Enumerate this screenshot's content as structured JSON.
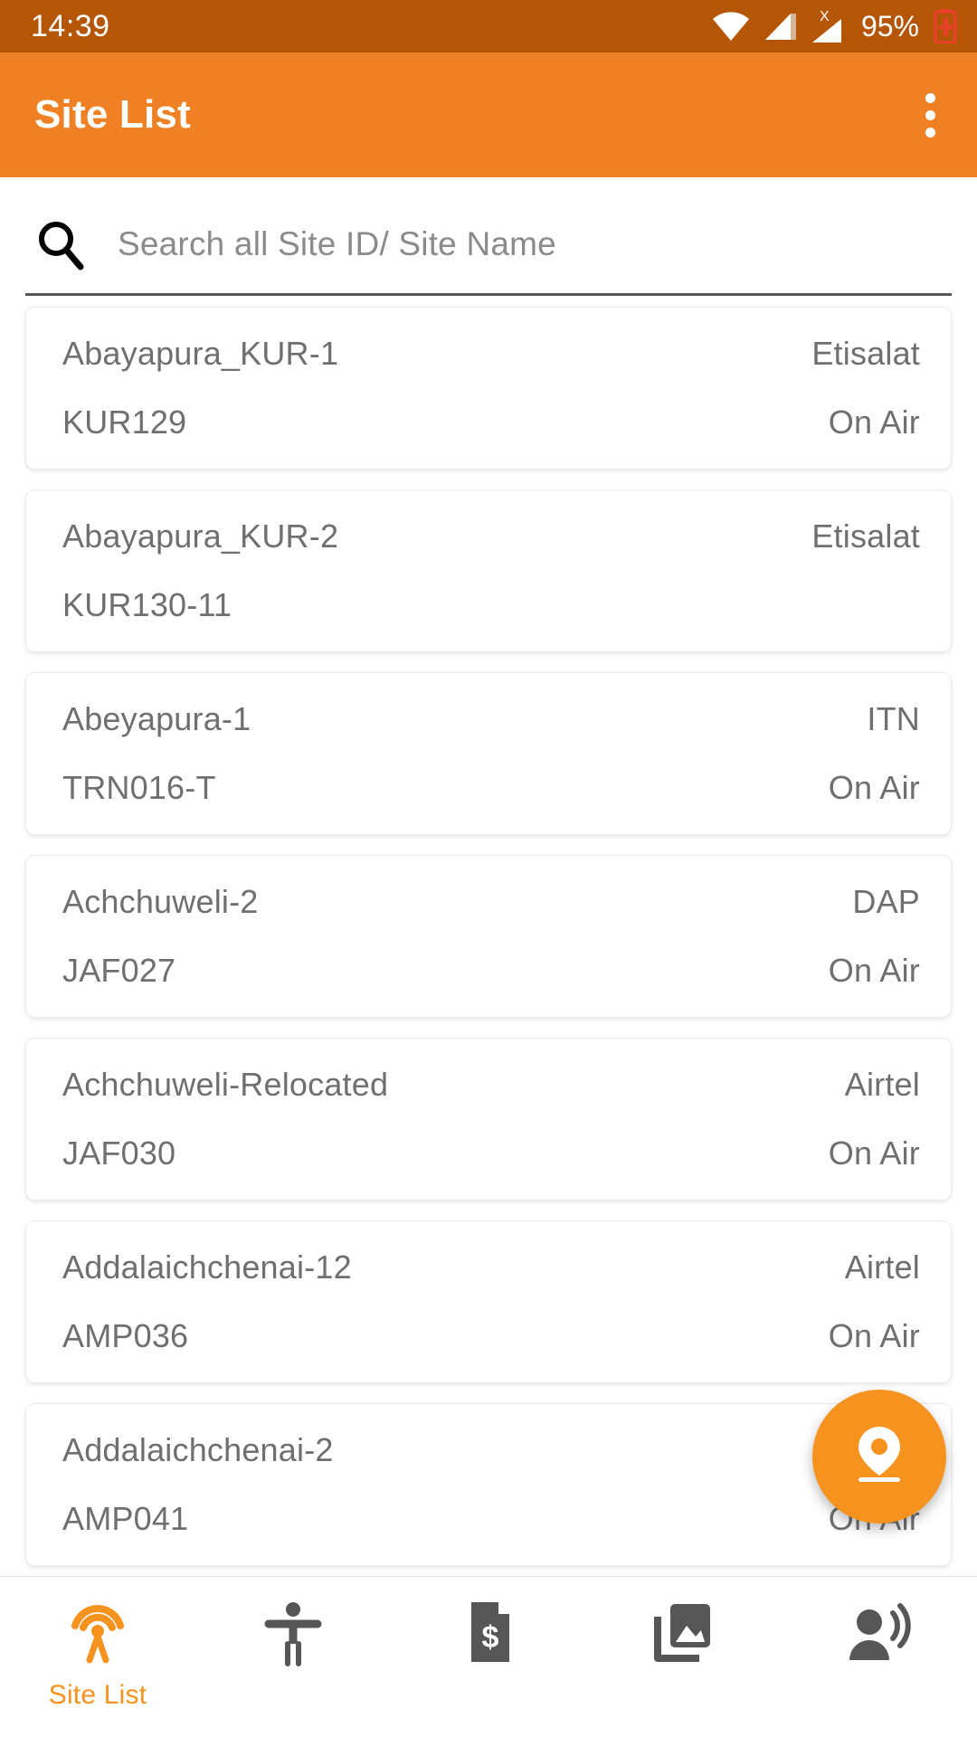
{
  "status_bar": {
    "time": "14:39",
    "battery_percent": "95%",
    "icons": [
      "wifi-icon",
      "signal-bars-icon",
      "no-sim-x-icon",
      "signal-bars-2-icon",
      "battery-charging-icon"
    ]
  },
  "app_bar": {
    "title": "Site List",
    "overflow_menu": "overflow-menu-icon"
  },
  "search": {
    "icon": "search-icon",
    "placeholder": "Search all Site ID/ Site Name",
    "value": ""
  },
  "site_list": [
    {
      "name": "Abayapura_KUR-1",
      "id": "KUR129",
      "operator": "Etisalat",
      "status": "On Air"
    },
    {
      "name": "Abayapura_KUR-2",
      "id": "KUR130-11",
      "operator": "Etisalat",
      "status": ""
    },
    {
      "name": "Abeyapura-1",
      "id": "TRN016-T",
      "operator": "ITN",
      "status": "On Air"
    },
    {
      "name": "Achchuweli-2",
      "id": "JAF027",
      "operator": "DAP",
      "status": "On Air"
    },
    {
      "name": "Achchuweli-Relocated",
      "id": "JAF030",
      "operator": "Airtel",
      "status": "On Air"
    },
    {
      "name": "Addalaichchenai-12",
      "id": "AMP036",
      "operator": "Airtel",
      "status": "On Air"
    },
    {
      "name": "Addalaichchenai-2",
      "id": "AMP041",
      "operator": "",
      "status": "On Air"
    }
  ],
  "fab": {
    "icon": "location-pin-icon"
  },
  "bottom_nav": {
    "items": [
      {
        "icon": "cell-tower-icon",
        "label": "Site List",
        "active": true
      },
      {
        "icon": "accessibility-icon",
        "label": "",
        "active": false
      },
      {
        "icon": "invoice-dollar-icon",
        "label": "",
        "active": false
      },
      {
        "icon": "gallery-image-icon",
        "label": "",
        "active": false
      },
      {
        "icon": "person-broadcast-icon",
        "label": "",
        "active": false
      }
    ]
  },
  "colors": {
    "status_bar_bg": "#b55606",
    "app_bar_bg": "#ef8023",
    "accent": "#f6921e",
    "text_primary": "#6f6f6f",
    "placeholder": "#8b8b8b"
  }
}
